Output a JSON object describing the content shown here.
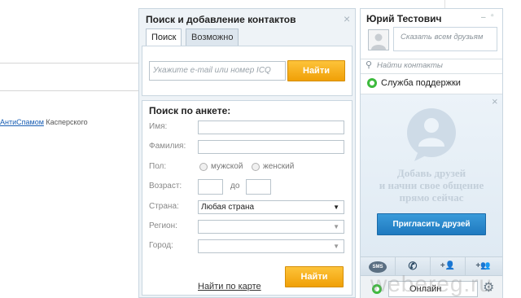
{
  "background": {
    "link_text": "АнтиСпамом",
    "rest_text": " Касперского"
  },
  "search_panel": {
    "title": "Поиск и добавление контактов",
    "close_glyph": "×",
    "tabs": [
      {
        "label": "Поиск",
        "active": true
      },
      {
        "label": "Возможно вы знакомы",
        "active": false
      }
    ],
    "quick_search": {
      "placeholder": "Укажите e-mail или номер ICQ",
      "button_label": "Найти"
    },
    "form": {
      "title": "Поиск по анкете:",
      "first_name_label": "Имя:",
      "last_name_label": "Фамилия:",
      "gender_label": "Пол:",
      "gender_male": "мужской",
      "gender_female": "женский",
      "age_label": "Возраст:",
      "age_to": "до",
      "country_label": "Страна:",
      "country_value": "Любая страна",
      "region_label": "Регион:",
      "city_label": "Город:",
      "button_label": "Найти",
      "map_link": "Найти по карте"
    }
  },
  "contacts_panel": {
    "user_name": "Юрий Тестович",
    "minimize_glyph": "–",
    "maximize_glyph": "▫",
    "status_placeholder": "Сказать всем друзьям",
    "find_placeholder": "Найти контакты",
    "support_label": "Служба поддержки",
    "close_glyph": "×",
    "promo_lines": [
      "Добавь друзей",
      "и начни свое общение",
      "прямо сейчас"
    ],
    "invite_button": "Пригласить друзей",
    "toolbar": [
      "sms",
      "phone",
      "add-contact",
      "add-group"
    ],
    "status_value": "Онлайн",
    "colors": {
      "accent_orange": "#f6a90f",
      "accent_blue": "#2a8acd",
      "icq_green": "#3dba3d"
    }
  },
  "watermark": "webereg.ru"
}
